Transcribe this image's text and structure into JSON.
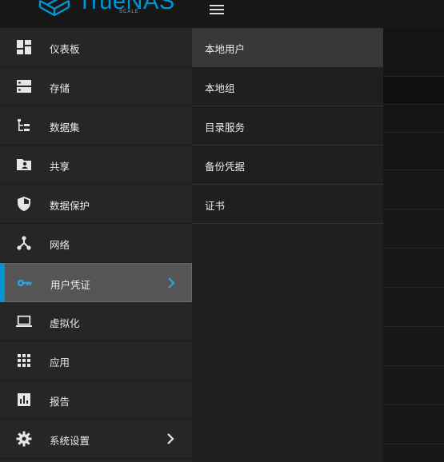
{
  "brand": {
    "name": "TrueNAS",
    "edition": "SCALE",
    "color": "#0095d5"
  },
  "nav": {
    "items": [
      {
        "label": "仪表板",
        "icon": "dashboard-icon"
      },
      {
        "label": "存储",
        "icon": "storage-icon"
      },
      {
        "label": "数据集",
        "icon": "datasets-icon"
      },
      {
        "label": "共享",
        "icon": "shares-icon"
      },
      {
        "label": "数据保护",
        "icon": "shield-icon"
      },
      {
        "label": "网络",
        "icon": "network-icon"
      },
      {
        "label": "用户凭证",
        "icon": "key-icon",
        "active": true,
        "has_submenu": true
      },
      {
        "label": "虚拟化",
        "icon": "laptop-icon"
      },
      {
        "label": "应用",
        "icon": "apps-grid-icon"
      },
      {
        "label": "报告",
        "icon": "reports-icon"
      },
      {
        "label": "系统设置",
        "icon": "gear-icon",
        "has_submenu": true
      }
    ]
  },
  "submenu": {
    "items": [
      {
        "label": "本地用户",
        "active": true
      },
      {
        "label": "本地组"
      },
      {
        "label": "目录服务"
      },
      {
        "label": "备份凭据"
      },
      {
        "label": "证书"
      }
    ]
  },
  "colors": {
    "accent": "#0095d5",
    "active_bg": "#555555"
  }
}
